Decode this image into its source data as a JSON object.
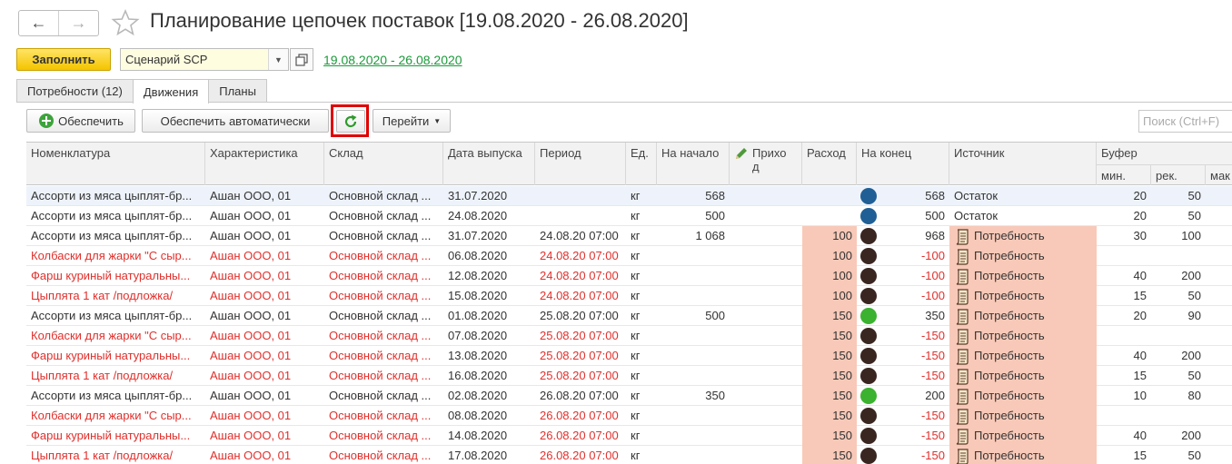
{
  "window": {
    "title": "Планирование цепочек поставок [19.08.2020 - 26.08.2020]",
    "back_label": "←",
    "forward_label": "→"
  },
  "toolbar": {
    "fill_label": "Заполнить",
    "scenario_value": "Сценарий SCP",
    "period_link": "19.08.2020 - 26.08.2020"
  },
  "tabs": [
    {
      "label": "Потребности (12)",
      "active": false
    },
    {
      "label": "Движения",
      "active": true
    },
    {
      "label": "Планы",
      "active": false
    }
  ],
  "actions": {
    "provide_label": "Обеспечить",
    "provide_auto_label": "Обеспечить автоматически",
    "goto_label": "Перейти",
    "search_placeholder": "Поиск (Ctrl+F)"
  },
  "columns": {
    "nomenclature": "Номенклатура",
    "characteristic": "Характеристика",
    "warehouse": "Склад",
    "release_date": "Дата выпуска",
    "period": "Период",
    "unit": "Ед.",
    "start": "На начало",
    "income": "Приход",
    "expense": "Расход",
    "end": "На конец",
    "source": "Источник",
    "buffer": "Буфер",
    "buffer_min": "мин.",
    "buffer_rec": "рек.",
    "buffer_max": "мак"
  },
  "colors": {
    "accent_red": "#e0302c",
    "link_green": "#1b9a3a",
    "highlight_pink": "#f8c9b8",
    "status_blue": "#1f5f95",
    "status_green": "#3bb230",
    "status_dark": "#3a2621"
  },
  "rows": [
    {
      "name": "Ассорти из мяса цыплят-бр...",
      "char": "Ашан ООО, 01",
      "wh": "Основной склад ...",
      "date": "31.07.2020",
      "period": "",
      "unit": "кг",
      "start": "568",
      "income": "",
      "expense": "",
      "status": "blue",
      "end": "568",
      "source": "Остаток",
      "bmin": "20",
      "brec": "50",
      "red": false,
      "sel": true
    },
    {
      "name": "Ассорти из мяса цыплят-бр...",
      "char": "Ашан ООО, 01",
      "wh": "Основной склад ...",
      "date": "24.08.2020",
      "period": "",
      "unit": "кг",
      "start": "500",
      "income": "",
      "expense": "",
      "status": "blue",
      "end": "500",
      "source": "Остаток",
      "bmin": "20",
      "brec": "50",
      "red": false,
      "sel": false
    },
    {
      "name": "Ассорти из мяса цыплят-бр...",
      "char": "Ашан ООО, 01",
      "wh": "Основной склад ...",
      "date": "31.07.2020",
      "period": "24.08.20 07:00",
      "unit": "кг",
      "start": "1 068",
      "income": "",
      "expense": "100",
      "status": "dark",
      "end": "968",
      "source": "Потребность",
      "bmin": "30",
      "brec": "100",
      "red": false,
      "sel": false
    },
    {
      "name": "Колбаски для жарки \"С сыр...",
      "char": "Ашан ООО, 01",
      "wh": "Основной склад ...",
      "date": "06.08.2020",
      "period": "24.08.20 07:00",
      "unit": "кг",
      "start": "",
      "income": "",
      "expense": "100",
      "status": "dark",
      "end": "-100",
      "source": "Потребность",
      "bmin": "",
      "brec": "",
      "red": true,
      "sel": false
    },
    {
      "name": "Фарш куриный натуральны...",
      "char": "Ашан ООО, 01",
      "wh": "Основной склад ...",
      "date": "12.08.2020",
      "period": "24.08.20 07:00",
      "unit": "кг",
      "start": "",
      "income": "",
      "expense": "100",
      "status": "dark",
      "end": "-100",
      "source": "Потребность",
      "bmin": "40",
      "brec": "200",
      "red": true,
      "sel": false
    },
    {
      "name": "Цыплята 1 кат /подложка/",
      "char": "Ашан ООО, 01",
      "wh": "Основной склад ...",
      "date": "15.08.2020",
      "period": "24.08.20 07:00",
      "unit": "кг",
      "start": "",
      "income": "",
      "expense": "100",
      "status": "dark",
      "end": "-100",
      "source": "Потребность",
      "bmin": "15",
      "brec": "50",
      "red": true,
      "sel": false
    },
    {
      "name": "Ассорти из мяса цыплят-бр...",
      "char": "Ашан ООО, 01",
      "wh": "Основной склад ...",
      "date": "01.08.2020",
      "period": "25.08.20 07:00",
      "unit": "кг",
      "start": "500",
      "income": "",
      "expense": "150",
      "status": "green",
      "end": "350",
      "source": "Потребность",
      "bmin": "20",
      "brec": "90",
      "red": false,
      "sel": false
    },
    {
      "name": "Колбаски для жарки \"С сыр...",
      "char": "Ашан ООО, 01",
      "wh": "Основной склад ...",
      "date": "07.08.2020",
      "period": "25.08.20 07:00",
      "unit": "кг",
      "start": "",
      "income": "",
      "expense": "150",
      "status": "dark",
      "end": "-150",
      "source": "Потребность",
      "bmin": "",
      "brec": "",
      "red": true,
      "sel": false
    },
    {
      "name": "Фарш куриный натуральны...",
      "char": "Ашан ООО, 01",
      "wh": "Основной склад ...",
      "date": "13.08.2020",
      "period": "25.08.20 07:00",
      "unit": "кг",
      "start": "",
      "income": "",
      "expense": "150",
      "status": "dark",
      "end": "-150",
      "source": "Потребность",
      "bmin": "40",
      "brec": "200",
      "red": true,
      "sel": false
    },
    {
      "name": "Цыплята 1 кат /подложка/",
      "char": "Ашан ООО, 01",
      "wh": "Основной склад ...",
      "date": "16.08.2020",
      "period": "25.08.20 07:00",
      "unit": "кг",
      "start": "",
      "income": "",
      "expense": "150",
      "status": "dark",
      "end": "-150",
      "source": "Потребность",
      "bmin": "15",
      "brec": "50",
      "red": true,
      "sel": false
    },
    {
      "name": "Ассорти из мяса цыплят-бр...",
      "char": "Ашан ООО, 01",
      "wh": "Основной склад ...",
      "date": "02.08.2020",
      "period": "26.08.20 07:00",
      "unit": "кг",
      "start": "350",
      "income": "",
      "expense": "150",
      "status": "green",
      "end": "200",
      "source": "Потребность",
      "bmin": "10",
      "brec": "80",
      "red": false,
      "sel": false
    },
    {
      "name": "Колбаски для жарки \"С сыр...",
      "char": "Ашан ООО, 01",
      "wh": "Основной склад ...",
      "date": "08.08.2020",
      "period": "26.08.20 07:00",
      "unit": "кг",
      "start": "",
      "income": "",
      "expense": "150",
      "status": "dark",
      "end": "-150",
      "source": "Потребность",
      "bmin": "",
      "brec": "",
      "red": true,
      "sel": false
    },
    {
      "name": "Фарш куриный натуральны...",
      "char": "Ашан ООО, 01",
      "wh": "Основной склад ...",
      "date": "14.08.2020",
      "period": "26.08.20 07:00",
      "unit": "кг",
      "start": "",
      "income": "",
      "expense": "150",
      "status": "dark",
      "end": "-150",
      "source": "Потребность",
      "bmin": "40",
      "brec": "200",
      "red": true,
      "sel": false
    },
    {
      "name": "Цыплята 1 кат /подложка/",
      "char": "Ашан ООО, 01",
      "wh": "Основной склад ...",
      "date": "17.08.2020",
      "period": "26.08.20 07:00",
      "unit": "кг",
      "start": "",
      "income": "",
      "expense": "150",
      "status": "dark",
      "end": "-150",
      "source": "Потребность",
      "bmin": "15",
      "brec": "50",
      "red": true,
      "sel": false
    }
  ]
}
